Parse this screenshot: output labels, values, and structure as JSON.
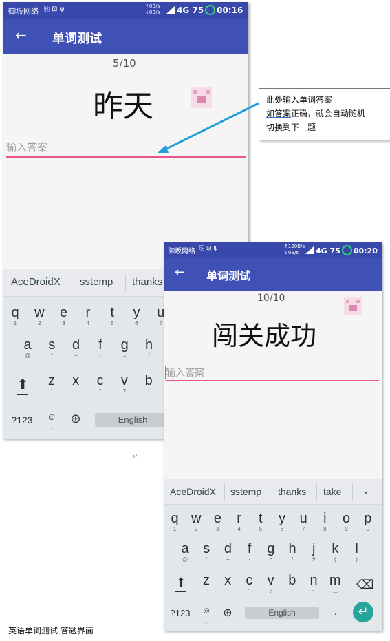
{
  "phone1": {
    "status": {
      "carrier": "御坂网络",
      "speed_up": "↑0B/s",
      "speed_down": "↓0B/s",
      "network": "4G",
      "battery": "75",
      "time": "00:16"
    },
    "appbar": {
      "title": "单词测试"
    },
    "progress": "5/10",
    "word": "昨天",
    "answer_placeholder": "输入答案",
    "suggestions": [
      "AceDroidX",
      "sstemp",
      "thanks"
    ],
    "keys_row1": [
      [
        "q",
        "1"
      ],
      [
        "w",
        "2"
      ],
      [
        "e",
        "3"
      ],
      [
        "r",
        "4"
      ],
      [
        "t",
        "5"
      ],
      [
        "y",
        "6"
      ],
      [
        "u",
        "7"
      ]
    ],
    "keys_row2": [
      [
        "a",
        "@"
      ],
      [
        "s",
        "*"
      ],
      [
        "d",
        "+"
      ],
      [
        "f",
        "-"
      ],
      [
        "g",
        "="
      ],
      [
        "h",
        "/"
      ]
    ],
    "keys_row3": [
      [
        "z",
        "'"
      ],
      [
        "x",
        ":"
      ],
      [
        "c",
        "\""
      ],
      [
        "v",
        "?"
      ],
      [
        "b",
        "!"
      ]
    ],
    "sym_label": "?123",
    "emoji": "☺",
    "space_label": "English"
  },
  "phone2": {
    "status": {
      "carrier": "御坂网络",
      "speed_up": "↑120B/s",
      "speed_down": "↓0B/s",
      "network": "4G",
      "battery": "75",
      "time": "00:20"
    },
    "appbar": {
      "title": "单词测试"
    },
    "progress": "10/10",
    "word": "闯关成功",
    "answer_placeholder": "输入答案",
    "suggestions": [
      "AceDroidX",
      "sstemp",
      "thanks",
      "take"
    ],
    "keys_row1": [
      [
        "q",
        "1"
      ],
      [
        "w",
        "2"
      ],
      [
        "e",
        "3"
      ],
      [
        "r",
        "4"
      ],
      [
        "t",
        "5"
      ],
      [
        "y",
        "6"
      ],
      [
        "u",
        "7"
      ],
      [
        "i",
        "8"
      ],
      [
        "o",
        "9"
      ],
      [
        "p",
        "0"
      ]
    ],
    "keys_row2": [
      [
        "a",
        "@"
      ],
      [
        "s",
        "*"
      ],
      [
        "d",
        "+"
      ],
      [
        "f",
        "-"
      ],
      [
        "g",
        "="
      ],
      [
        "h",
        "/"
      ],
      [
        "j",
        "#"
      ],
      [
        "k",
        "("
      ],
      [
        "l",
        ")"
      ]
    ],
    "keys_row3": [
      [
        "z",
        "'"
      ],
      [
        "x",
        ":"
      ],
      [
        "c",
        "\""
      ],
      [
        "v",
        "?"
      ],
      [
        "b",
        "!"
      ],
      [
        "n",
        "~"
      ],
      [
        "m",
        "…"
      ]
    ],
    "sym_label": "?123",
    "emoji": "☺",
    "space_label": "English",
    "period": "."
  },
  "callout": {
    "line1": "此处输入单词答案",
    "line2_underlined": "如答案",
    "line2_rest": "正确，就会自动随机",
    "line3": "切换到下一题"
  },
  "caption": "英语单词测试  答题界面",
  "colors": {
    "statusbar": "#3949ab",
    "appbar": "#3f51b5",
    "underline": "#e8578a",
    "enter": "#26a69a",
    "arrow": "#1e9fd8"
  }
}
